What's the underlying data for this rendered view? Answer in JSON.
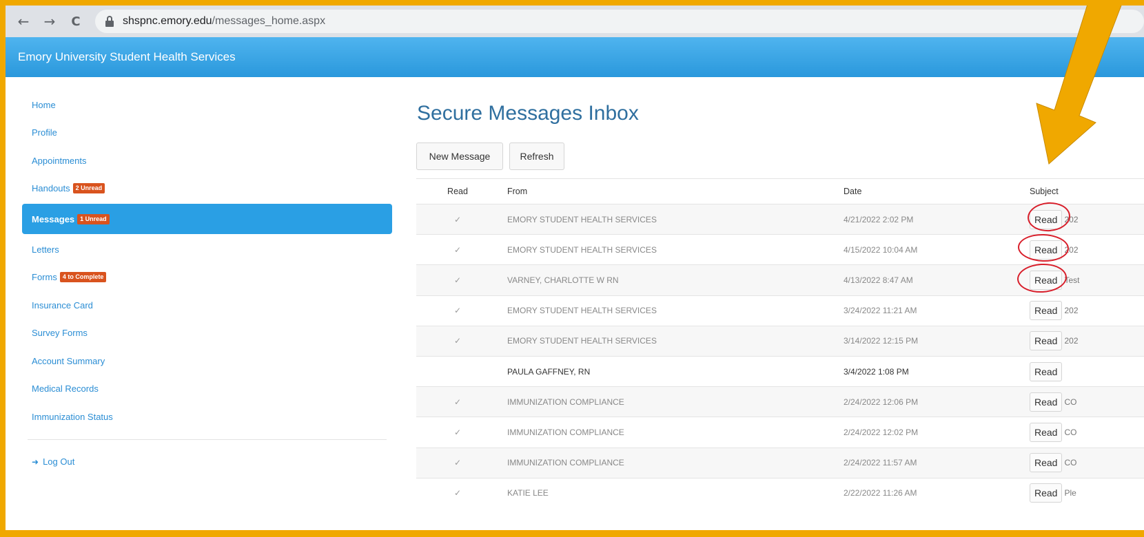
{
  "browser": {
    "back_icon": "←",
    "forward_icon": "→",
    "reload_icon": "C",
    "url_host": "shspnc.emory.edu",
    "url_path": "/messages_home.aspx"
  },
  "app": {
    "title": "Emory University Student Health Services"
  },
  "sidebar": {
    "items": [
      {
        "label": "Home"
      },
      {
        "label": "Profile"
      },
      {
        "label": "Appointments"
      },
      {
        "label": "Handouts",
        "badge": "2 Unread"
      },
      {
        "label": "Messages",
        "badge": "1 Unread",
        "active": true
      },
      {
        "label": "Letters"
      },
      {
        "label": "Forms",
        "badge": "4 to Complete"
      },
      {
        "label": "Insurance Card"
      },
      {
        "label": "Survey Forms"
      },
      {
        "label": "Account Summary"
      },
      {
        "label": "Medical Records"
      },
      {
        "label": "Immunization Status"
      }
    ],
    "logout_label": "Log Out"
  },
  "main": {
    "title": "Secure Messages Inbox",
    "new_message_label": "New Message",
    "refresh_label": "Refresh",
    "columns": {
      "read": "Read",
      "from": "From",
      "date": "Date",
      "subject": "Subject"
    },
    "read_button_label": "Read",
    "rows": [
      {
        "read": "✓",
        "from": "EMORY STUDENT HEALTH SERVICES",
        "date": "4/21/2022 2:02 PM",
        "subject": "202"
      },
      {
        "read": "✓",
        "from": "EMORY STUDENT HEALTH SERVICES",
        "date": "4/15/2022 10:04 AM",
        "subject": "202"
      },
      {
        "read": "✓",
        "from": "VARNEY, CHARLOTTE W RN",
        "date": "4/13/2022 8:47 AM",
        "subject": "Test"
      },
      {
        "read": "✓",
        "from": "EMORY STUDENT HEALTH SERVICES",
        "date": "3/24/2022 11:21 AM",
        "subject": "202"
      },
      {
        "read": "✓",
        "from": "EMORY STUDENT HEALTH SERVICES",
        "date": "3/14/2022 12:15 PM",
        "subject": "202"
      },
      {
        "read": "",
        "from": "PAULA GAFFNEY, RN",
        "date": "3/4/2022 1:08 PM",
        "subject": ""
      },
      {
        "read": "✓",
        "from": "IMMUNIZATION COMPLIANCE",
        "date": "2/24/2022 12:06 PM",
        "subject": "CO"
      },
      {
        "read": "✓",
        "from": "IMMUNIZATION COMPLIANCE",
        "date": "2/24/2022 12:02 PM",
        "subject": "CO"
      },
      {
        "read": "✓",
        "from": "IMMUNIZATION COMPLIANCE",
        "date": "2/24/2022 11:57 AM",
        "subject": "CO"
      },
      {
        "read": "✓",
        "from": "KATIE LEE",
        "date": "2/22/2022 11:26 AM",
        "subject": "Ple"
      }
    ]
  },
  "annotations": {
    "frame_color": "#f0a800",
    "arrow_color": "#f0a800",
    "circle_color": "#d81e2a"
  }
}
